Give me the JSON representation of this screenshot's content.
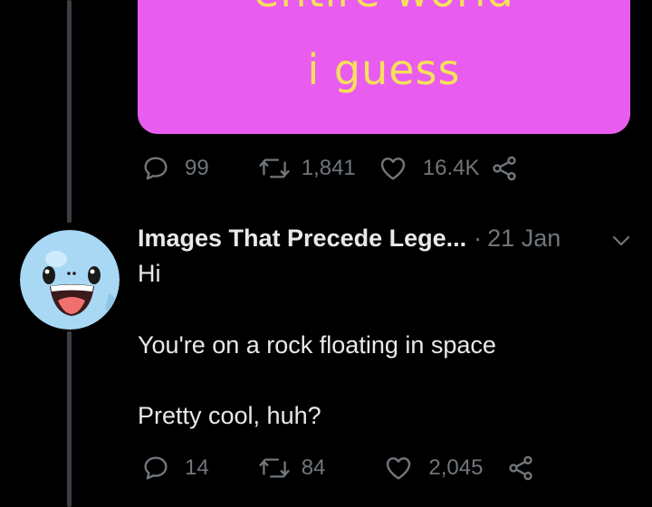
{
  "media": {
    "text_line1": "entire world",
    "text_line2": "i guess"
  },
  "tweet1": {
    "replies": "99",
    "retweets": "1,841",
    "likes": "16.4K"
  },
  "tweet2": {
    "author": "Images That Precede Lege...",
    "separator": "·",
    "date": "21 Jan",
    "lines": [
      "Hi",
      "You're on a rock floating in space",
      "Pretty cool, huh?"
    ],
    "replies": "14",
    "retweets": "84",
    "likes": "2,045"
  },
  "colors": {
    "background": "#000000",
    "media_bg": "#e95cf0",
    "media_text": "#f5e15a",
    "muted": "#71767b",
    "avatar_bg": "#a8d8f4"
  },
  "icons": [
    "reply-icon",
    "retweet-icon",
    "like-icon",
    "share-icon",
    "chevron-down-icon"
  ]
}
